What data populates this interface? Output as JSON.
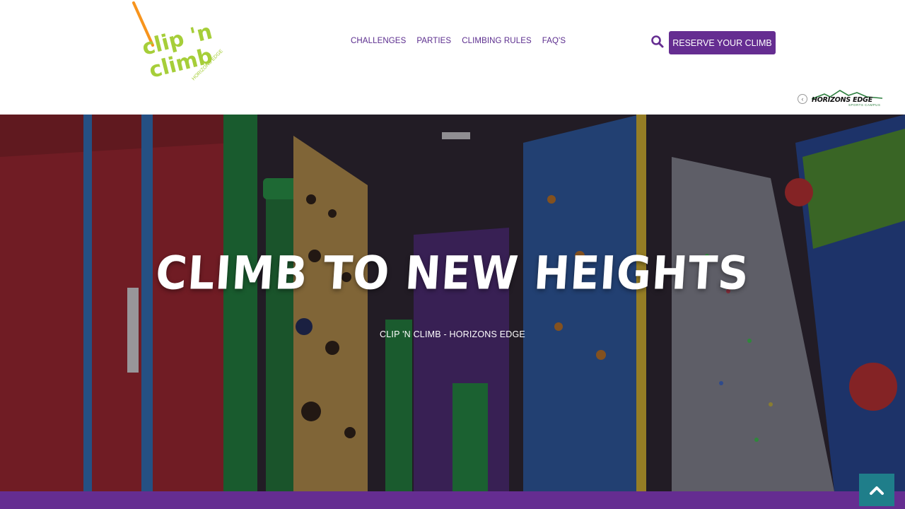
{
  "brand": {
    "logo_line1": "clip 'n",
    "logo_line2": "climb",
    "logo_location": "HORIZONS EDGE",
    "logo_color": "#a6ce39",
    "rope_color": "#f7941d"
  },
  "nav": {
    "items": [
      {
        "label": "CHALLENGES"
      },
      {
        "label": "PARTIES"
      },
      {
        "label": "CLIMBING RULES"
      },
      {
        "label": "FAQ'S"
      }
    ]
  },
  "header": {
    "search_icon": "search-icon",
    "cta_label": "RESERVE YOUR CLIMB",
    "accent": "#652d91"
  },
  "partner": {
    "name": "HORIZONS EDGE",
    "tagline": "SPORTS CAMPUS",
    "chevron_icon": "chevron-left-icon"
  },
  "hero": {
    "title": "CLIMB TO NEW HEIGHTS",
    "subtitle": "CLIP 'N CLIMB - HORIZONS EDGE"
  },
  "footer": {
    "back_to_top_icon": "chevron-up-icon",
    "bar_color": "#652d91",
    "button_color": "#1f7e8a"
  }
}
